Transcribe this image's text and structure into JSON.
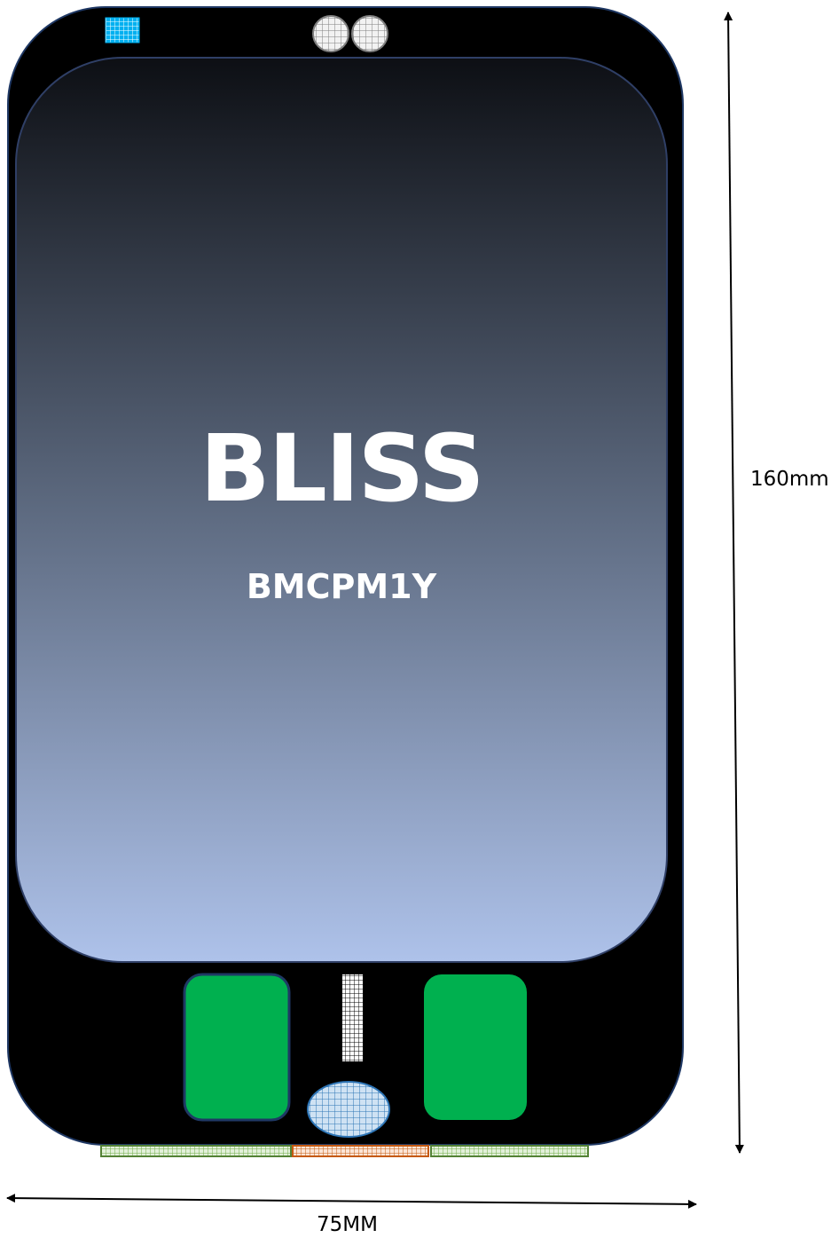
{
  "device": {
    "brand": "BLISS",
    "model": "BMCPM1Y"
  },
  "dimensions": {
    "height_label": "160mm",
    "width_label": "75MM"
  },
  "colors": {
    "body": "#000000",
    "outline": "#1f3864",
    "screen_top": "#0d0f14",
    "screen_bottom": "#aec2ea",
    "green_pad": "#00b04f",
    "sensor_blue": "#9dc3e6",
    "camera_gray": "#bfbfbf",
    "strip_green": "#a9d18e",
    "strip_orange": "#f4b183",
    "dimension_line": "#000000"
  }
}
